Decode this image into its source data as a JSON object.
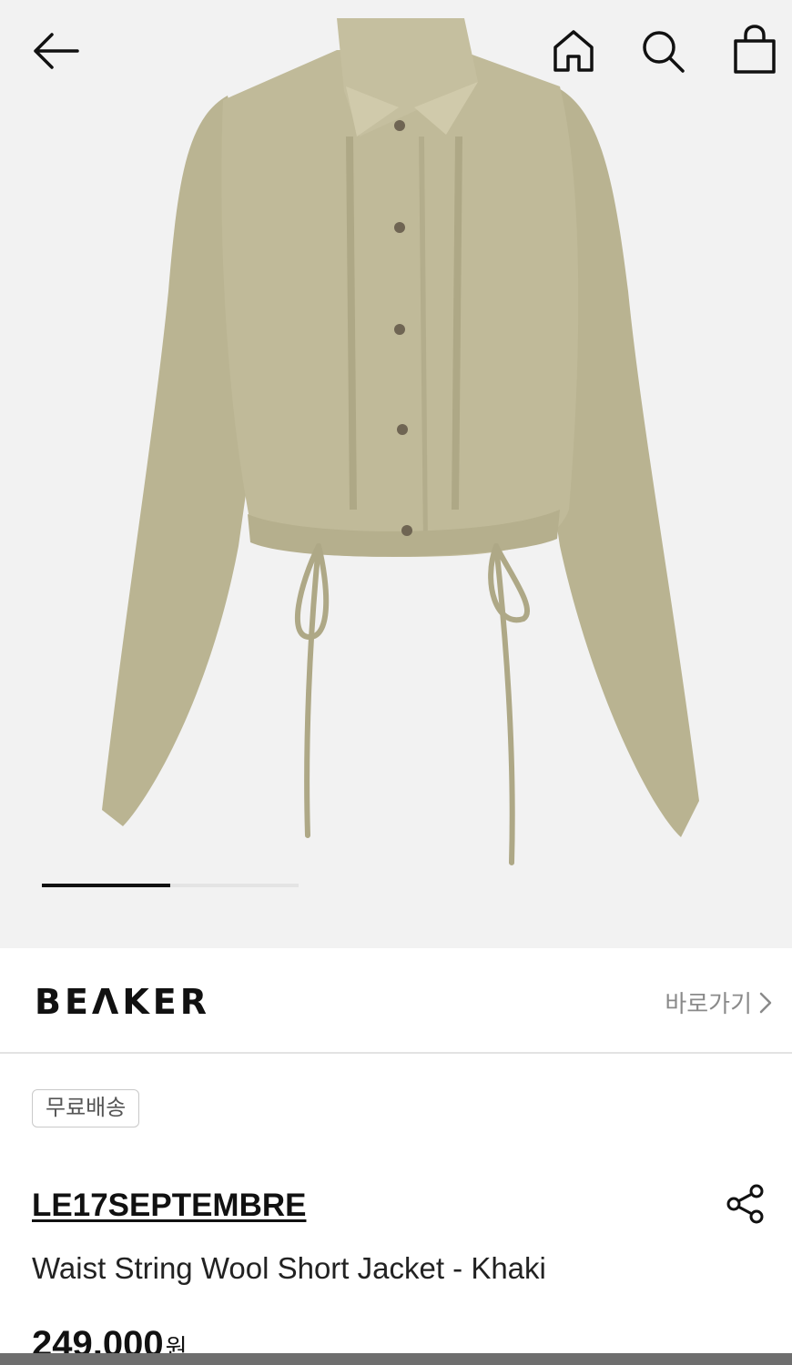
{
  "header": {
    "back_icon": "arrow-left-icon",
    "home_icon": "home-icon",
    "search_icon": "search-icon",
    "bag_icon": "shopping-bag-icon"
  },
  "gallery": {
    "image_subject": "khaki cropped jacket with waist drawstrings",
    "colors": {
      "background": "#f2f2f2",
      "fabric": "#bcb696"
    },
    "slide_progress": 0.5
  },
  "brand": {
    "logo": "BEΛKER",
    "shortcut_label": "바로가기",
    "shortcut_icon": "chevron-right-icon"
  },
  "product": {
    "badge": "무료배송",
    "designer": "LE17SEPTEMBRE",
    "name": "Waist String Wool Short Jacket - Khaki",
    "price": "249,000",
    "currency": "원",
    "share_icon": "share-icon"
  }
}
